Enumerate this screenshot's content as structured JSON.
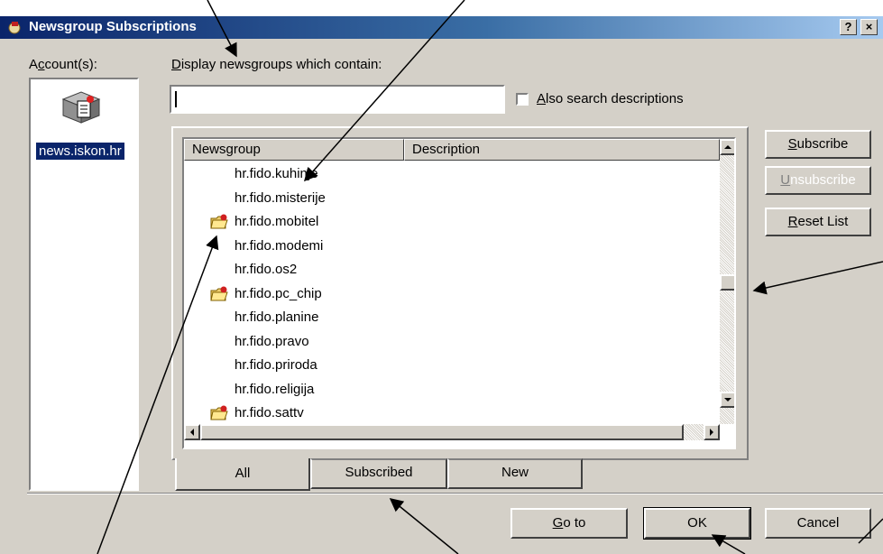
{
  "window": {
    "title": "Newsgroup Subscriptions",
    "help": "?",
    "close": "×"
  },
  "accounts": {
    "label_pre": "A",
    "label_ul": "c",
    "label_post": "count(s):",
    "items": [
      "news.iskon.hr"
    ]
  },
  "search": {
    "label_ul": "D",
    "label_post": "isplay newsgroups which contain:",
    "value": ""
  },
  "also_search": {
    "label_ul": "A",
    "label_post": "lso search descriptions",
    "checked": false
  },
  "list": {
    "columns": [
      "Newsgroup",
      "Description"
    ],
    "rows": [
      {
        "name": "hr.fido.kuhinje",
        "subscribed": false
      },
      {
        "name": "hr.fido.misterije",
        "subscribed": false
      },
      {
        "name": "hr.fido.mobitel",
        "subscribed": true
      },
      {
        "name": "hr.fido.modemi",
        "subscribed": false
      },
      {
        "name": "hr.fido.os2",
        "subscribed": false
      },
      {
        "name": "hr.fido.pc_chip",
        "subscribed": true
      },
      {
        "name": "hr.fido.planine",
        "subscribed": false
      },
      {
        "name": "hr.fido.pravo",
        "subscribed": false
      },
      {
        "name": "hr.fido.priroda",
        "subscribed": false
      },
      {
        "name": "hr.fido.religija",
        "subscribed": false
      },
      {
        "name": "hr.fido.sattv",
        "subscribed": true
      }
    ]
  },
  "side_buttons": {
    "subscribe": {
      "ul": "S",
      "rest": "ubscribe"
    },
    "unsubscribe": {
      "ul": "U",
      "rest": "nsubscribe"
    },
    "reset": {
      "ul": "R",
      "rest": "eset List"
    }
  },
  "tabs": [
    "All",
    "Subscribed",
    "New"
  ],
  "bottom_buttons": {
    "goto": {
      "ul": "G",
      "rest": "o to"
    },
    "ok": "OK",
    "cancel": "Cancel"
  },
  "colors": {
    "title_start": "#0a246a",
    "title_end": "#a6caf0",
    "face": "#d4d0c8",
    "selection": "#0a246a"
  }
}
